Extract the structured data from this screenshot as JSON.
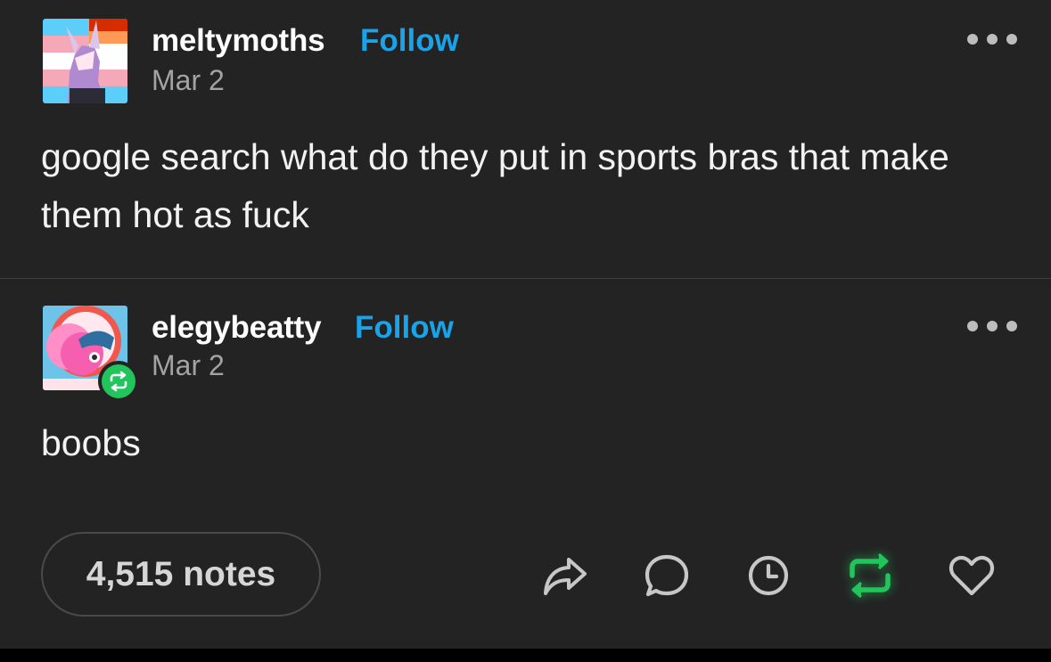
{
  "posts": [
    {
      "username": "meltymoths",
      "follow_label": "Follow",
      "date": "Mar 2",
      "body": "google search what do they put in sports bras that make them hot as fuck",
      "avatar": "avatar-image",
      "more_icon": "more-horizontal-icon"
    },
    {
      "username": "elegybeatty",
      "follow_label": "Follow",
      "date": "Mar 2",
      "body": "boobs",
      "avatar": "avatar-image",
      "badge_icon": "reblog-icon",
      "more_icon": "more-horizontal-icon"
    }
  ],
  "footer": {
    "notes_label": "4,515 notes",
    "actions": [
      {
        "name": "share",
        "icon": "share-arrow-icon"
      },
      {
        "name": "reply",
        "icon": "comment-bubble-icon"
      },
      {
        "name": "queue",
        "icon": "clock-icon"
      },
      {
        "name": "reblog",
        "icon": "reblog-icon"
      },
      {
        "name": "like",
        "icon": "heart-outline-icon"
      }
    ]
  },
  "colors": {
    "background": "#232323",
    "text": "#f2f2f2",
    "muted": "#a3a3a3",
    "follow_blue": "#1aa3e8",
    "reblog_green": "#21c55b",
    "icon_gray": "#bdbdbd"
  }
}
